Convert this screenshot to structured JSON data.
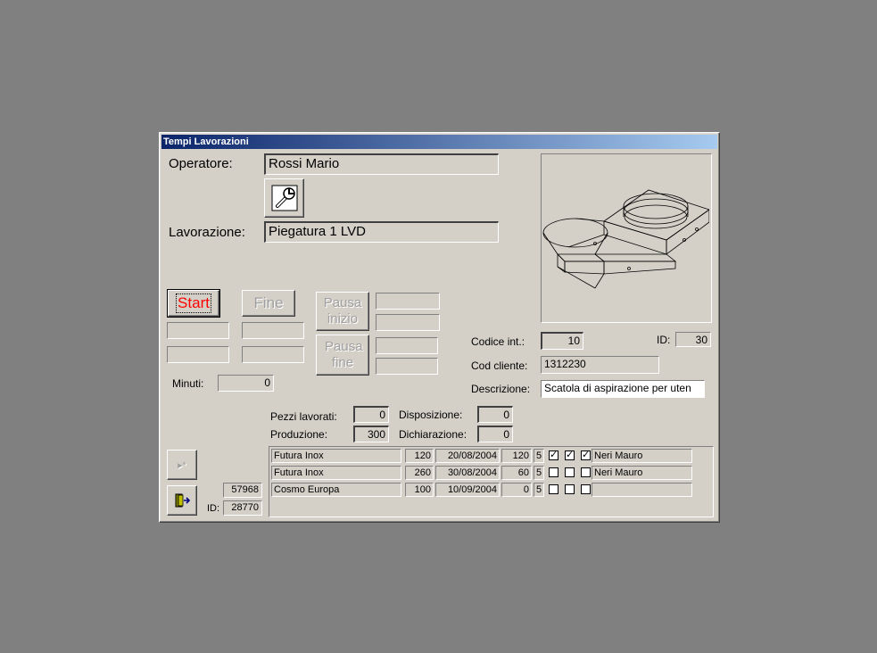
{
  "window": {
    "title": "Tempi Lavorazioni"
  },
  "operatore": {
    "label": "Operatore:",
    "value": "Rossi Mario"
  },
  "lavorazione": {
    "label": "Lavorazione:",
    "value": "Piegatura 1 LVD"
  },
  "buttons": {
    "start": "Start",
    "fine": "Fine",
    "pausa_inizio": "Pausa inizio",
    "pausa_fine": "Pausa fine"
  },
  "minuti": {
    "label": "Minuti:",
    "value": "0"
  },
  "codice_int": {
    "label": "Codice  int.:",
    "value": "10"
  },
  "id_top": {
    "label": "ID:",
    "value": "30"
  },
  "cod_cliente": {
    "label": "Cod cliente:",
    "value": "1312230"
  },
  "descrizione": {
    "label": "Descrizione:",
    "value": "Scatola di aspirazione per uten"
  },
  "pezzi_lavorati": {
    "label": "Pezzi lavorati:",
    "value": "0"
  },
  "produzione": {
    "label": "Produzione:",
    "value": "300"
  },
  "disposizione": {
    "label": "Disposizione:",
    "value": "0"
  },
  "dichiarazione": {
    "label": "Dichiarazione:",
    "value": "0"
  },
  "record": {
    "count": "57968",
    "id_label": "ID:",
    "id_value": "28770"
  },
  "icons": {
    "tool": "wrench-icon",
    "new_record": "new-record-icon",
    "exit": "exit-door-icon"
  },
  "rows": [
    {
      "cliente": "Futura Inox",
      "qty": "120",
      "date": "20/08/2004",
      "prod": "120",
      "n": "5",
      "c1": true,
      "c2": true,
      "c3": true,
      "operator": "Neri Mauro"
    },
    {
      "cliente": "Futura Inox",
      "qty": "260",
      "date": "30/08/2004",
      "prod": "60",
      "n": "5",
      "c1": false,
      "c2": false,
      "c3": false,
      "operator": "Neri Mauro"
    },
    {
      "cliente": "Cosmo Europa",
      "qty": "100",
      "date": "10/09/2004",
      "prod": "0",
      "n": "5",
      "c1": false,
      "c2": false,
      "c3": false,
      "operator": ""
    }
  ]
}
